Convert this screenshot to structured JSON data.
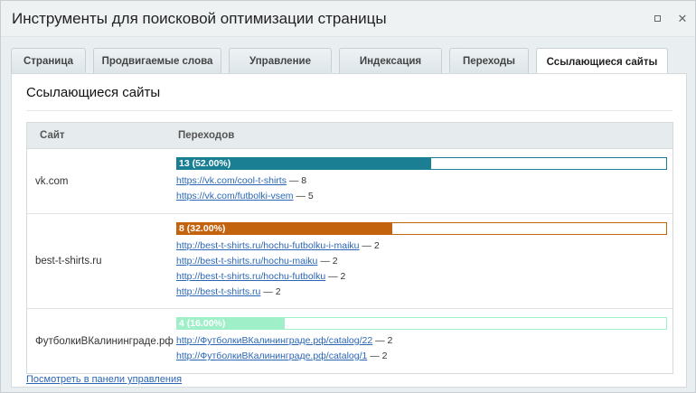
{
  "window": {
    "title": "Инструменты для поисковой оптимизации страницы"
  },
  "tabs": [
    {
      "label": "Страница"
    },
    {
      "label": "Продвигаемые слова"
    },
    {
      "label": "Управление"
    },
    {
      "label": "Индексация"
    },
    {
      "label": "Переходы"
    },
    {
      "label": "Ссылающиеся сайты"
    }
  ],
  "active_tab": "Ссылающиеся сайты",
  "panel": {
    "heading": "Ссылающиеся сайты"
  },
  "table": {
    "headers": {
      "site": "Сайт",
      "transitions": "Переходов"
    },
    "rows": [
      {
        "site": "vk.com",
        "bar_label": "13 (52.00%)",
        "share": 0.52,
        "bar_color": "#1a7f93",
        "links": [
          {
            "url": "https://vk.com/cool-t-shirts",
            "count": "— 8"
          },
          {
            "url": "https://vk.com/futbolki-vsem",
            "count": "— 5"
          }
        ]
      },
      {
        "site": "best-t-shirts.ru",
        "bar_label": "8 (32.00%)",
        "share": 0.44,
        "bar_color": "#c4630e",
        "links": [
          {
            "url": "http://best-t-shirts.ru/hochu-futbolku-i-maiku",
            "count": "— 2"
          },
          {
            "url": "http://best-t-shirts.ru/hochu-maiku",
            "count": "— 2"
          },
          {
            "url": "http://best-t-shirts.ru/hochu-futbolku",
            "count": "— 2"
          },
          {
            "url": "http://best-t-shirts.ru",
            "count": "— 2"
          }
        ]
      },
      {
        "site": "ФутболкиВКалининграде.рф",
        "bar_label": "4 (16.00%)",
        "share": 0.22,
        "bar_color": "#9fefc8",
        "links": [
          {
            "url": "http://ФутболкиВКалининграде.рф/catalog/22",
            "count": "— 2"
          },
          {
            "url": "http://ФутболкиВКалининграде.рф/catalog/1",
            "count": "— 2"
          }
        ]
      }
    ]
  },
  "footer_link": "Посмотреть в панели управления"
}
